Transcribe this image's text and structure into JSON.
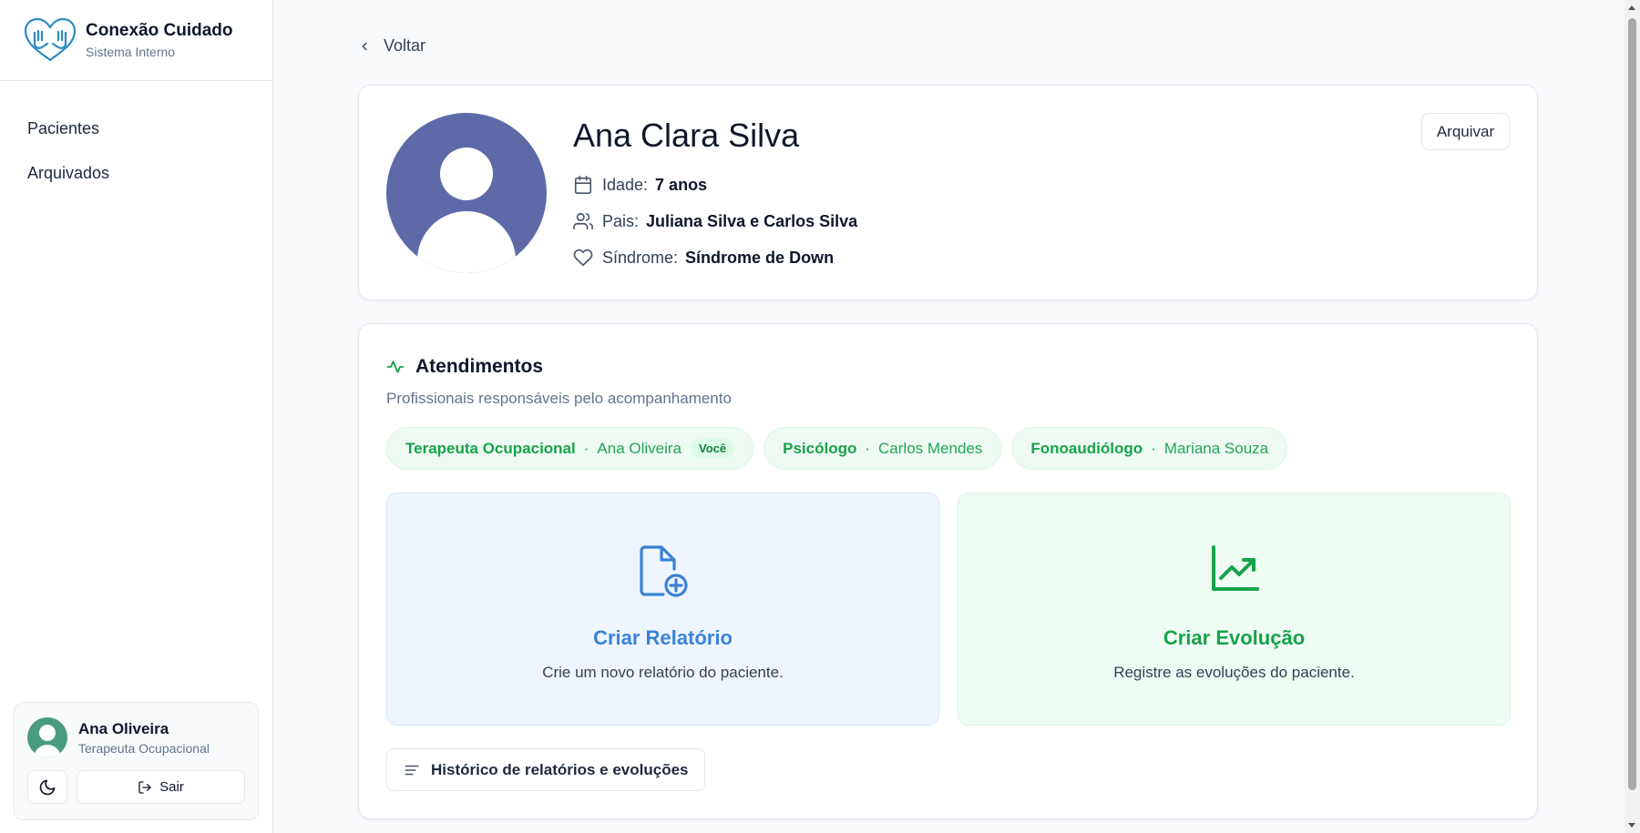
{
  "brand": {
    "name": "Conexão Cuidado",
    "subtitle": "Sistema Interno"
  },
  "nav": {
    "items": [
      {
        "label": "Pacientes"
      },
      {
        "label": "Arquivados"
      }
    ]
  },
  "user": {
    "name": "Ana Oliveira",
    "role": "Terapeuta Ocupacional",
    "logout_label": "Sair"
  },
  "back_label": "Voltar",
  "patient": {
    "name": "Ana Clara Silva",
    "archive_label": "Arquivar",
    "age_label": "Idade:",
    "age": "7 anos",
    "parents_label": "Pais:",
    "parents": "Juliana Silva e Carlos Silva",
    "syndrome_label": "Síndrome:",
    "syndrome": "Síndrome de Down"
  },
  "appointments": {
    "title": "Atendimentos",
    "subtitle": "Profissionais responsáveis pelo acompanhamento",
    "professionals": [
      {
        "role": "Terapeuta Ocupacional",
        "name": "Ana Oliveira",
        "badge": "Você"
      },
      {
        "role": "Psicólogo",
        "name": "Carlos Mendes"
      },
      {
        "role": "Fonoaudiólogo",
        "name": "Mariana Souza"
      }
    ],
    "report": {
      "title": "Criar Relatório",
      "description": "Crie um novo relatório do paciente."
    },
    "evolution": {
      "title": "Criar Evolução",
      "description": "Registre as evoluções do paciente."
    },
    "history_label": "Histórico de relatórios e evoluções"
  },
  "icons": {
    "brand": "heart-hands-icon",
    "theme": "moon-icon",
    "logout": "logout-icon",
    "back": "chevron-left-icon",
    "age": "calendar-icon",
    "parents": "users-icon",
    "syndrome": "heart-icon",
    "appointments": "activity-icon",
    "report": "file-plus-icon",
    "evolution": "trending-up-icon",
    "history": "list-icon"
  },
  "colors": {
    "accent_green": "#16a34a",
    "accent_blue": "#3b82d6",
    "avatar": "#5e6aa8",
    "user_avatar": "#4a9c7e"
  }
}
